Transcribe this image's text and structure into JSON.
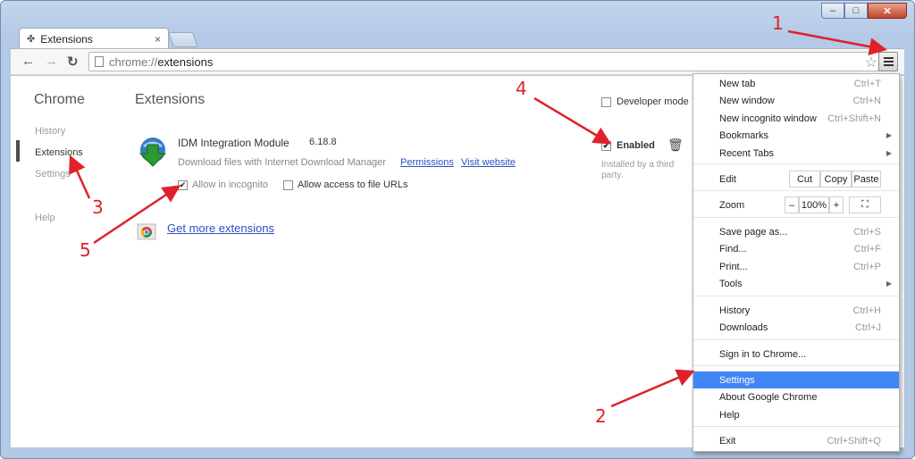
{
  "window": {
    "minimize": "–",
    "maximize": "□",
    "close": "✕"
  },
  "tab": {
    "title": "Extensions",
    "close": "×"
  },
  "toolbar": {
    "url_scheme": "chrome://",
    "url_path": "extensions",
    "back": "←",
    "forward": "→",
    "reload": "↻",
    "star": "☆"
  },
  "sidebar": {
    "title": "Chrome",
    "items": [
      "History",
      "Extensions",
      "Settings",
      "Help"
    ]
  },
  "main": {
    "title": "Extensions",
    "developer_mode": "Developer mode",
    "extension": {
      "name": "IDM Integration Module",
      "version": "6.18.8",
      "description": "Download files with Internet Download Manager",
      "permissions": "Permissions",
      "visit": "Visit website",
      "allow_incognito": "Allow in incognito",
      "allow_files": "Allow access to file URLs",
      "enabled": "Enabled",
      "third_party": "Installed by a third party."
    },
    "get_more": "Get more extensions"
  },
  "menu": {
    "new_tab": "New tab",
    "new_tab_sc": "Ctrl+T",
    "new_window": "New window",
    "new_window_sc": "Ctrl+N",
    "incognito": "New incognito window",
    "incognito_sc": "Ctrl+Shift+N",
    "bookmarks": "Bookmarks",
    "recent": "Recent Tabs",
    "edit": "Edit",
    "cut": "Cut",
    "copy": "Copy",
    "paste": "Paste",
    "zoom": "Zoom",
    "zoom_minus": "–",
    "zoom_value": "100%",
    "zoom_plus": "+",
    "save": "Save page as...",
    "save_sc": "Ctrl+S",
    "find": "Find...",
    "find_sc": "Ctrl+F",
    "print": "Print...",
    "print_sc": "Ctrl+P",
    "tools": "Tools",
    "history": "History",
    "history_sc": "Ctrl+H",
    "downloads": "Downloads",
    "downloads_sc": "Ctrl+J",
    "signin": "Sign in to Chrome...",
    "settings": "Settings",
    "about": "About Google Chrome",
    "help": "Help",
    "exit": "Exit",
    "exit_sc": "Ctrl+Shift+Q"
  },
  "annotations": [
    "1",
    "2",
    "3",
    "4",
    "5"
  ],
  "colors": {
    "annotation": "#e0212b",
    "highlight": "#4285f4",
    "link": "#2a52c4"
  }
}
